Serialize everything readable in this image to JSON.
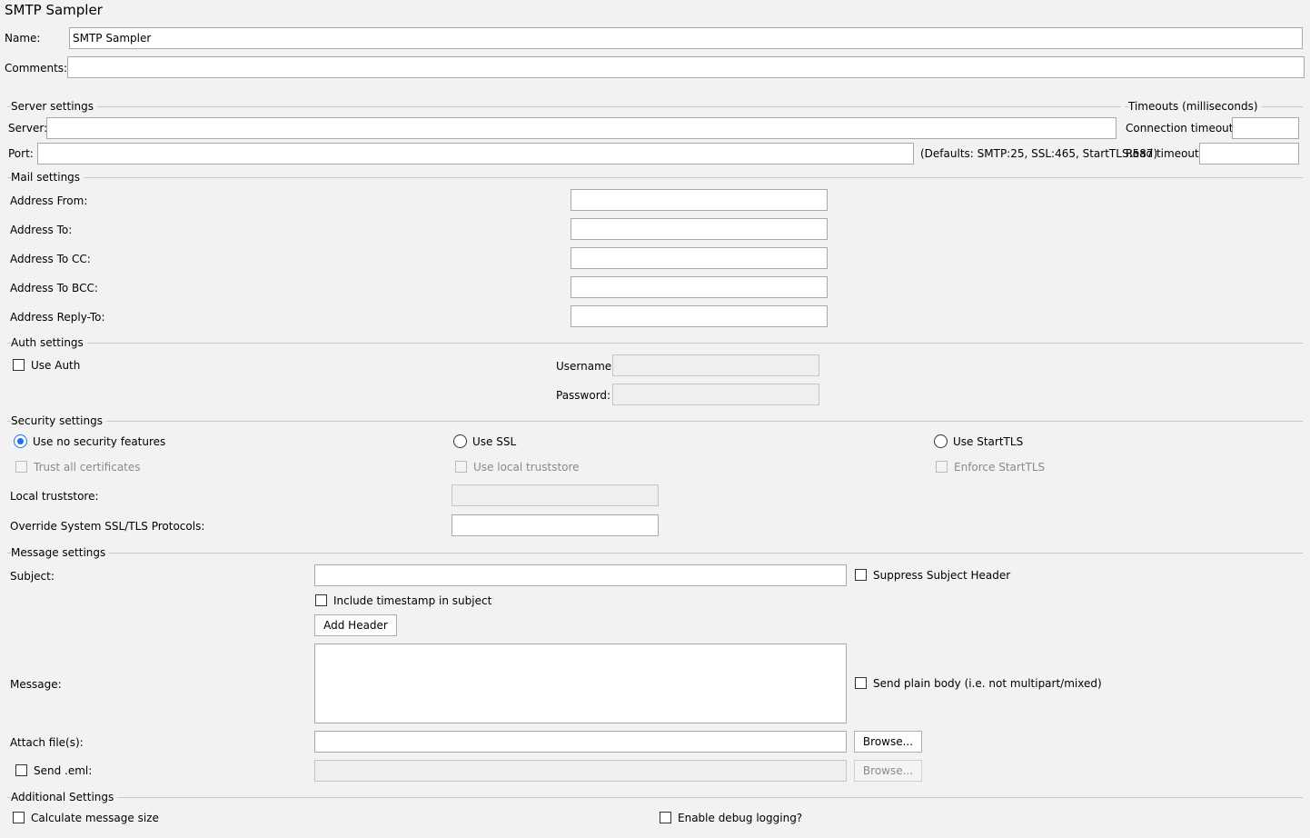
{
  "panel_title": "SMTP Sampler",
  "name": {
    "label": "Name:",
    "value": "SMTP Sampler"
  },
  "comments": {
    "label": "Comments:",
    "value": ""
  },
  "server_settings": {
    "title": "Server settings",
    "server_label": "Server:",
    "server_value": "",
    "port_label": "Port:",
    "port_value": "",
    "defaults_note": "(Defaults: SMTP:25, SSL:465, StartTLS:587)"
  },
  "timeouts": {
    "title": "Timeouts (milliseconds)",
    "connection_label": "Connection timeout:",
    "connection_value": "",
    "read_label": "Read timeout:",
    "read_value": ""
  },
  "mail_settings": {
    "title": "Mail settings",
    "address_from": "Address From:",
    "address_to": "Address To:",
    "address_cc": "Address To CC:",
    "address_bcc": "Address To BCC:",
    "address_reply_to": "Address Reply-To:"
  },
  "auth_settings": {
    "title": "Auth settings",
    "use_auth": "Use Auth",
    "use_auth_checked": false,
    "username_label": "Username:",
    "password_label": "Password:"
  },
  "security_settings": {
    "title": "Security settings",
    "options": [
      "Use no security features",
      "Use SSL",
      "Use StartTLS"
    ],
    "selected": "Use no security features",
    "trust_all": "Trust all certificates",
    "use_local_truststore": "Use local truststore",
    "enforce_starttls": "Enforce StartTLS",
    "local_truststore_label": "Local truststore:",
    "override_protocols_label": "Override System SSL/TLS Protocols:"
  },
  "message_settings": {
    "title": "Message settings",
    "subject_label": "Subject:",
    "suppress_subject": "Suppress Subject Header",
    "include_timestamp": "Include timestamp in subject",
    "add_header_button": "Add Header",
    "message_label": "Message:",
    "send_plain_body": "Send plain body (i.e. not multipart/mixed)",
    "attach_label": "Attach file(s):",
    "browse_button": "Browse...",
    "send_eml": "Send .eml:",
    "browse_eml_button": "Browse..."
  },
  "additional_settings": {
    "title": "Additional Settings",
    "calc_size": "Calculate message size",
    "debug_logging": "Enable debug logging?"
  },
  "colors": {
    "accent": "#1a73e8",
    "background": "#f2f2f2"
  }
}
